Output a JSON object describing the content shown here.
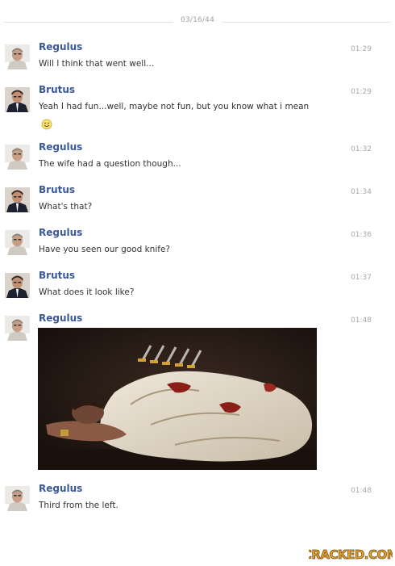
{
  "conversation": {
    "date": "03/16/44",
    "messages": [
      {
        "sender": "Regulus",
        "time": "01:29",
        "text": "Will I think that went well...",
        "avatar": "regulus"
      },
      {
        "sender": "Brutus",
        "time": "01:29",
        "text": "Yeah I had fun...well, maybe not fun, but you know what i mean",
        "avatar": "brutus",
        "emoji": "smiley-icon"
      },
      {
        "sender": "Regulus",
        "time": "01:32",
        "text": "The wife had a question though...",
        "avatar": "regulus"
      },
      {
        "sender": "Brutus",
        "time": "01:34",
        "text": "What's that?",
        "avatar": "brutus"
      },
      {
        "sender": "Regulus",
        "time": "01:36",
        "text": "Have you seen our good knife?",
        "avatar": "regulus"
      },
      {
        "sender": "Brutus",
        "time": "01:37",
        "text": "What does it look like?",
        "avatar": "brutus"
      },
      {
        "sender": "Regulus",
        "time": "01:48",
        "text": "",
        "avatar": "regulus",
        "attachment": "photo"
      },
      {
        "sender": "Regulus",
        "time": "01:48",
        "text": "Third from the left.",
        "avatar": "regulus"
      }
    ]
  },
  "watermark": {
    "text": "CRACKED.COM"
  },
  "colors": {
    "sender": "#3b5998",
    "time": "#a8a8a8",
    "text": "#333333",
    "divider": "#e3e3e3",
    "logo": "#e3a52c"
  }
}
